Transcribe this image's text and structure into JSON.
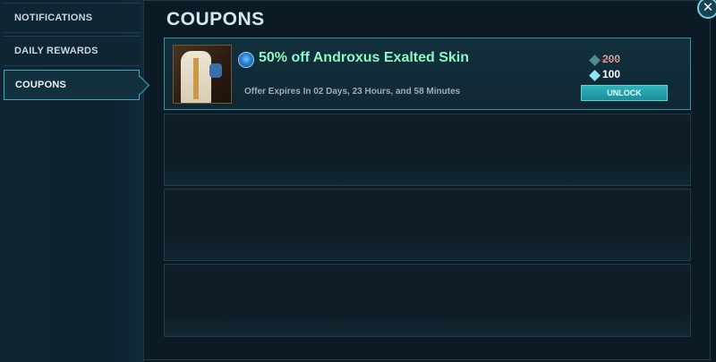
{
  "sidebar": {
    "items": [
      {
        "label": "NOTIFICATIONS",
        "active": false
      },
      {
        "label": "DAILY REWARDS",
        "active": false
      },
      {
        "label": "COUPONS",
        "active": true
      }
    ]
  },
  "main": {
    "title": "COUPONS",
    "close_icon": "close-icon",
    "coupons": [
      {
        "name": "50% off Androxus Exalted Skin",
        "expiry": "Offer Expires In 02 Days, 23 Hours, and 58 Minutes",
        "original_price": "200",
        "price": "100",
        "currency_icon": "crystal-gem-icon",
        "button_label": "UNLOCK",
        "icon": "skin-badge-icon"
      }
    ],
    "empty_slots": 3
  },
  "colors": {
    "accent": "#3fa9bd",
    "coupon_name": "#8ff5c2",
    "button": "#2db3be",
    "strike": "#e23a3a"
  }
}
